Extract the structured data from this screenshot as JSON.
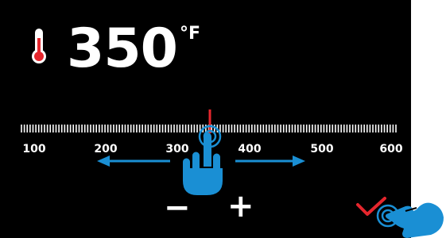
{
  "temperature": {
    "value": "350",
    "unit": "°F"
  },
  "scale": {
    "min": 100,
    "max": 600,
    "current": 350,
    "labels": [
      "100",
      "200",
      "300",
      "400",
      "500",
      "600"
    ]
  },
  "controls": {
    "minus": "−",
    "plus": "+"
  },
  "icons": {
    "thermometer": "thermometer-icon",
    "slider_hand": "hand-pointer-icon",
    "confirm": "checkmark-icon",
    "confirm_hand": "hand-pointer-icon"
  },
  "colors": {
    "background": "#000000",
    "text": "#ffffff",
    "accent_red": "#e5262d",
    "accent_blue": "#1a8fd4"
  }
}
